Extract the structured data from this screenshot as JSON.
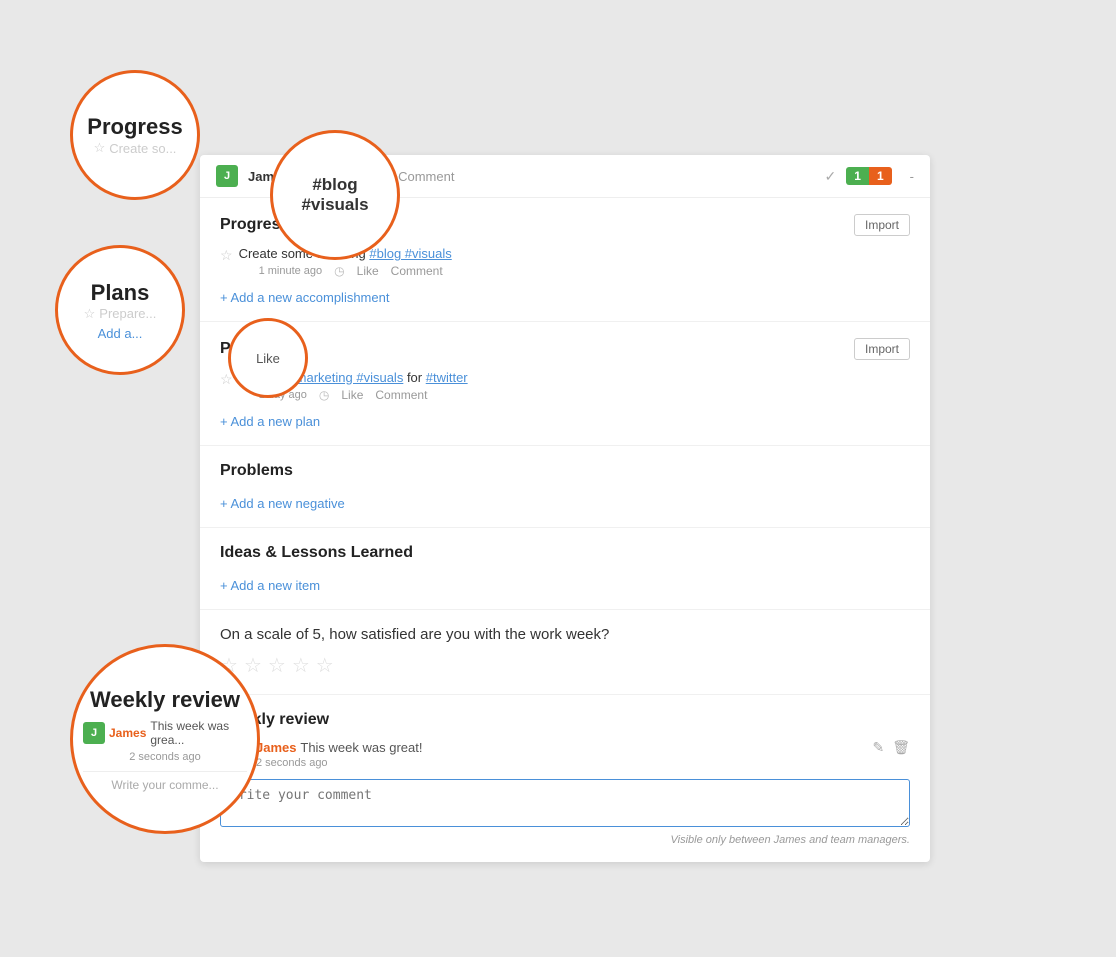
{
  "annotations": {
    "circle_progress": {
      "title": "Progress",
      "sub": "Create so..."
    },
    "circle_plans": {
      "title": "Plans",
      "sub": "Prepare..."
    },
    "circle_tag": {
      "tags": "#blog #visuals"
    },
    "circle_like": {
      "label": "Like"
    },
    "circle_weekly": {
      "title": "Weekly review",
      "author": "James",
      "text": "This week was grea..."
    }
  },
  "topbar": {
    "user_name": "James",
    "tags": "#blog #visuals",
    "comment_placeholder": "Comment",
    "badge_green": "1",
    "badge_orange": "1",
    "dash": "-"
  },
  "progress": {
    "section_title": "Progress",
    "import_label": "Import",
    "item_star": "☆",
    "item_text_prefix": "Create some stunning ",
    "item_tags": "#blog #visuals",
    "item_time": "1 minute ago",
    "item_like": "Like",
    "item_comment": "Comment",
    "add_label": "+ Add a new accomplishment"
  },
  "plans": {
    "section_title": "Plans",
    "import_label": "Import",
    "item_star": "☆",
    "item_text_prefix": "Prepare ",
    "item_tags_marketing": "#marketing #visuals",
    "item_text_for": " for ",
    "item_tag_twitter": "#twitter",
    "item_time": "1 day ago",
    "item_like": "Like",
    "item_comment": "Comment",
    "add_label": "+ Add a new plan"
  },
  "problems": {
    "section_title": "Problems",
    "add_label": "+ Add a new negative"
  },
  "ideas": {
    "section_title": "Ideas & Lessons Learned",
    "add_label": "+ Add a new item"
  },
  "satisfaction": {
    "question": "On a scale of 5, how satisfied are you with the work week?",
    "stars": [
      "☆",
      "☆",
      "☆",
      "☆",
      "☆"
    ]
  },
  "weekly_review": {
    "section_title": "Weekly review",
    "author": "James",
    "text": "This week was great!",
    "time": "2 seconds ago",
    "comment_placeholder": "Write your comment",
    "visibility_note": "Visible only between James and team managers."
  }
}
